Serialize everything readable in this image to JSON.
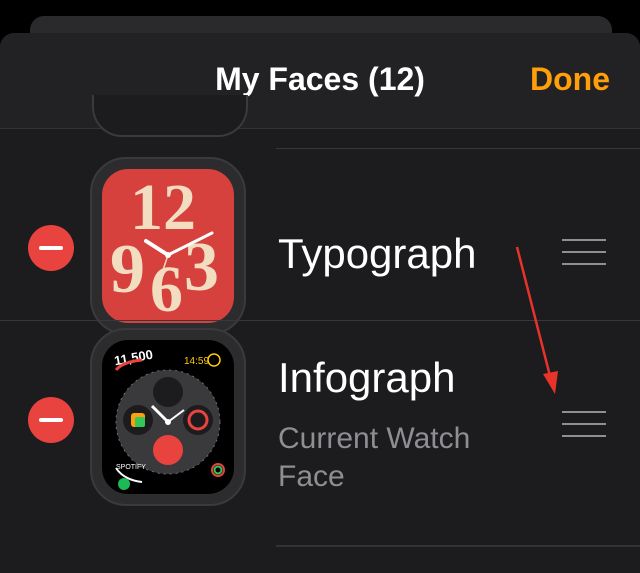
{
  "header": {
    "title": "My Faces (12)",
    "done_label": "Done"
  },
  "faces": [
    {
      "name": "Typograph",
      "numerals": [
        "12",
        "9",
        "6",
        "3"
      ]
    },
    {
      "name": "Infograph",
      "subtitle": "Current Watch Face",
      "steps": "11,500",
      "time": "14:59",
      "music_label": "SPOTIFY"
    }
  ],
  "colors": {
    "accent": "#ff9f0a",
    "delete": "#e8433f",
    "annotation_arrow": "#e8332a"
  }
}
